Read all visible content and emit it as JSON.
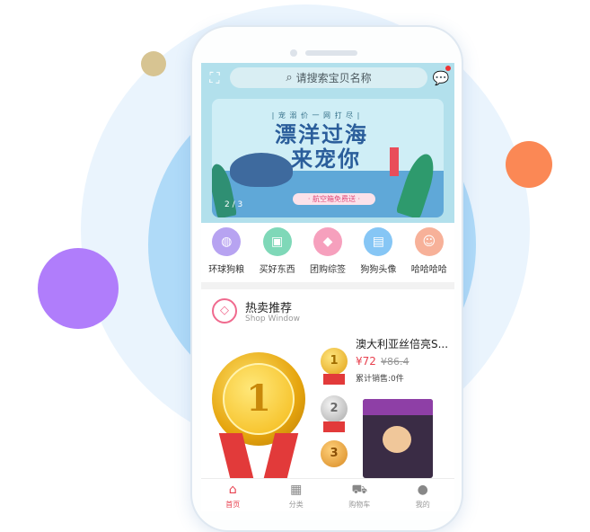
{
  "search": {
    "placeholder": "请搜索宝贝名称"
  },
  "banner": {
    "tagline": "| 宠 溺 价   一 网 打 尽 |",
    "title_line1": "漂洋过海",
    "title_line2": "来宠你",
    "subtitle": "· 航空箱免费送 ·",
    "page_indicator": "2 / 3"
  },
  "categories": [
    {
      "label": "环球狗粮",
      "icon": "planet-icon",
      "color": "#b7a3f1"
    },
    {
      "label": "买好东西",
      "icon": "bag-icon",
      "color": "#7fd8b8"
    },
    {
      "label": "团购综签",
      "icon": "tag-icon",
      "color": "#f6a0bd"
    },
    {
      "label": "狗狗头像",
      "icon": "photo-icon",
      "color": "#86c6f5"
    },
    {
      "label": "哈哈哈哈",
      "icon": "people-icon",
      "color": "#f7b199"
    }
  ],
  "hot": {
    "title": "热卖推荐",
    "subtitle": "Shop Window",
    "ranks": [
      "1",
      "2",
      "3"
    ],
    "product": {
      "name": "澳大利亚丝倍亮S...",
      "price": "¥72",
      "original_price": "¥86.4",
      "sold": "累计销售:0件"
    }
  },
  "tabbar": [
    {
      "label": "首页",
      "icon": "home-icon",
      "active": true
    },
    {
      "label": "分类",
      "icon": "grid-icon",
      "active": false
    },
    {
      "label": "购物车",
      "icon": "cart-icon",
      "active": false
    },
    {
      "label": "我的",
      "icon": "user-icon",
      "active": false
    }
  ],
  "colors": {
    "accent": "#e8414f",
    "header": "#b2e0ec"
  }
}
